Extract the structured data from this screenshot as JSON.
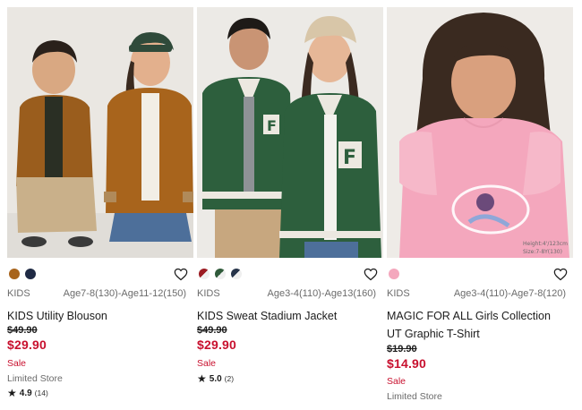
{
  "products": [
    {
      "gender": "KIDS",
      "sizes": "Age7-8(130)-Age11-12(150)",
      "name_lines": [
        "KIDS Utility Blouson"
      ],
      "original_price": "$49.90",
      "sale_price": "$29.90",
      "sale_label": "Sale",
      "availability": "Limited Store",
      "rating": "4.9",
      "reviews": "(14)",
      "swatches": [
        "#a8641c",
        "#1f2a44"
      ]
    },
    {
      "gender": "KIDS",
      "sizes": "Age3-4(110)-Age13(160)",
      "name_lines": [
        "KIDS Sweat Stadium Jacket"
      ],
      "original_price": "$49.90",
      "sale_price": "$29.90",
      "sale_label": "Sale",
      "availability": "",
      "rating": "5.0",
      "reviews": "(2)",
      "swatches": [
        "#9b1b22",
        "#2f5a3a",
        "#263449"
      ]
    },
    {
      "gender": "KIDS",
      "sizes": "Age3-4(110)-Age7-8(120)",
      "name_lines": [
        "MAGIC FOR ALL Girls Collection",
        "UT Graphic T-Shirt"
      ],
      "original_price": "$19.90",
      "sale_price": "$14.90",
      "sale_label": "Sale",
      "availability": "Limited Store",
      "rating": "",
      "reviews": "",
      "swatches": [
        "#f4a7bd"
      ],
      "photo_caption": [
        "Height:4'/123cm",
        "Size:7-8Y(130)"
      ]
    }
  ],
  "icons": {
    "wishlist": "heart-outline-icon",
    "rating": "star-icon"
  },
  "colors": {
    "sale_red": "#c8102e",
    "muted_text": "#6b6b6b"
  }
}
